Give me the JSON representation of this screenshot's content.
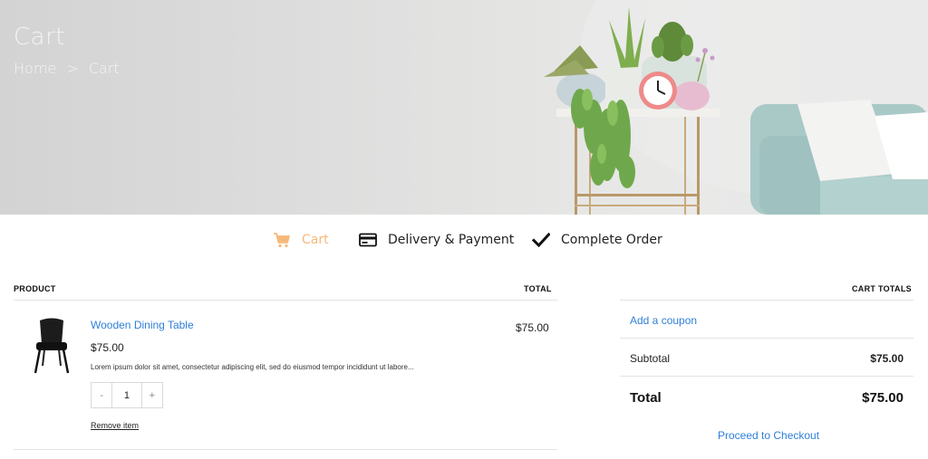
{
  "hero": {
    "title": "Cart",
    "breadcrumb": {
      "home": "Home",
      "separator": ">",
      "current": "Cart"
    }
  },
  "steps": [
    {
      "label": "Cart",
      "icon": "cart-icon",
      "active": true
    },
    {
      "label": "Delivery & Payment",
      "icon": "credit-card-icon",
      "active": false
    },
    {
      "label": "Complete Order",
      "icon": "checkmark-icon",
      "active": false
    }
  ],
  "cart_table": {
    "headers": {
      "product": "PRODUCT",
      "total": "TOTAL"
    },
    "items": [
      {
        "name": "Wooden Dining Table",
        "price": "$75.00",
        "description": "Lorem ipsum dolor sit amet, consectetur adipiscing elit, sed do eiusmod tempor incididunt ut labore...",
        "quantity": "1",
        "decrement": "-",
        "increment": "+",
        "remove_label": "Remove item",
        "total": "$75.00"
      }
    ]
  },
  "cart_totals": {
    "header": "CART TOTALS",
    "coupon_label": "Add a coupon",
    "subtotal_label": "Subtotal",
    "subtotal_value": "$75.00",
    "total_label": "Total",
    "total_value": "$75.00",
    "checkout_label": "Proceed to Checkout"
  },
  "colors": {
    "accent": "#f5b97a",
    "link": "#2f7fd8",
    "divider": "#e3e3e3"
  }
}
